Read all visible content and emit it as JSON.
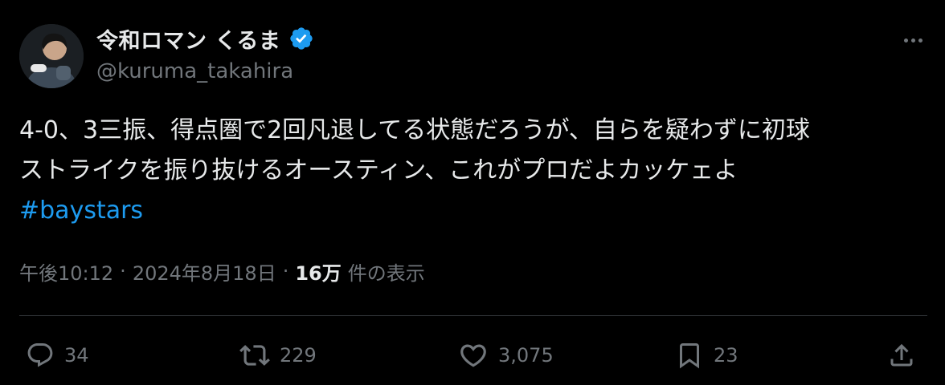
{
  "author": {
    "display_name": "令和ロマン くるま",
    "handle": "@kuruma_takahira",
    "verified": true
  },
  "tweet": {
    "text_lines": [
      "4-0、3三振、得点圏で2回凡退してる状態だろうが、自らを疑わずに初球",
      "ストライクを振り抜けるオースティン、これがプロだよカッケェよ"
    ],
    "hashtag": "#baystars"
  },
  "meta": {
    "time": "午後10:12",
    "separator": "·",
    "date": "2024年8月18日",
    "views_count": "16万",
    "views_label": "件の表示"
  },
  "actions": {
    "replies": "34",
    "reposts": "229",
    "likes": "3,075",
    "bookmarks": "23"
  },
  "colors": {
    "background": "#000000",
    "text_primary": "#e7e9ea",
    "text_secondary": "#71767b",
    "accent": "#1d9bf0",
    "divider": "#2f3336"
  },
  "icons": {
    "verified": "verified-badge-icon",
    "more": "more-horizontal-icon",
    "reply": "reply-icon",
    "repost": "repost-icon",
    "like": "heart-icon",
    "bookmark": "bookmark-icon",
    "share": "share-icon"
  }
}
